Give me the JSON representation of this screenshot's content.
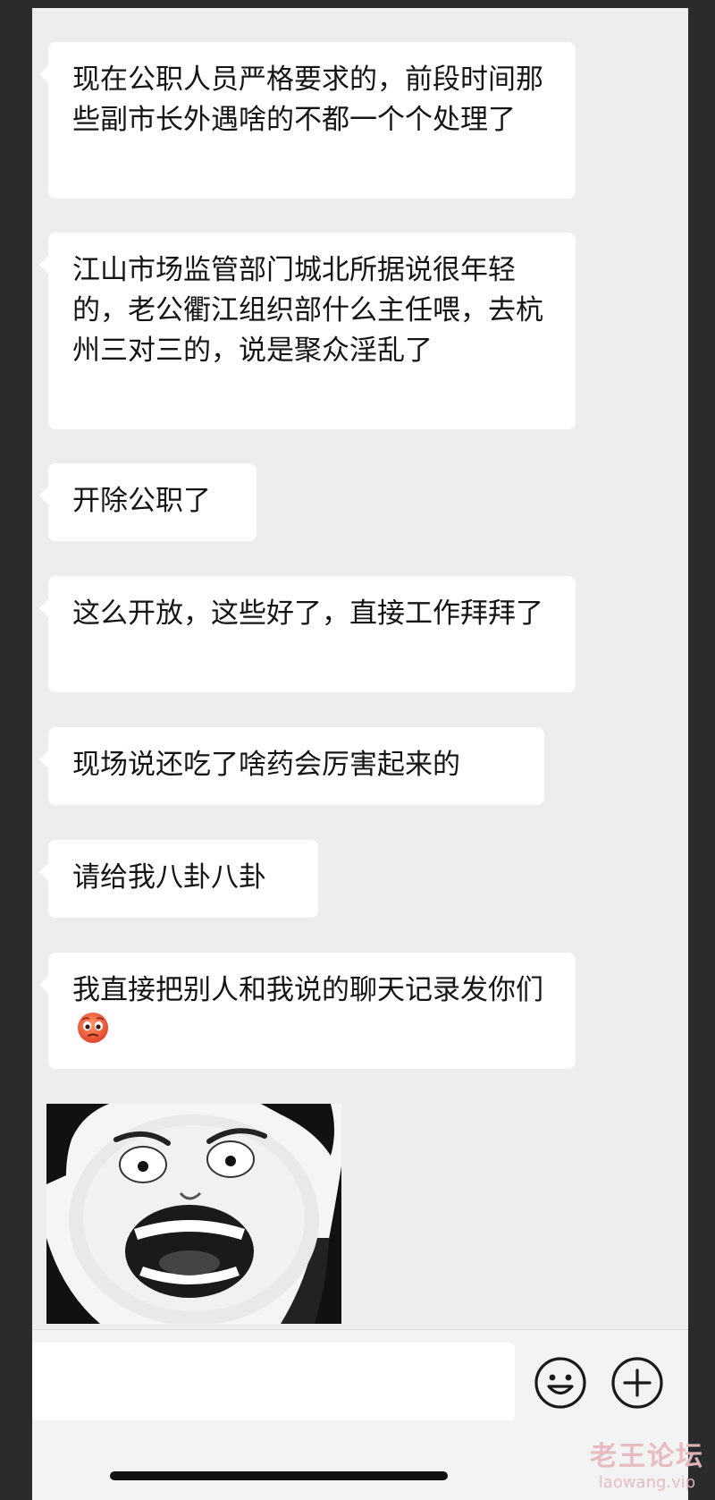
{
  "messages": [
    {
      "text": "现在公职人员严格要求的，前段时间那些副市长外遇啥的不都一个个处理了"
    },
    {
      "text": "江山市场监管部门城北所据说很年轻的，老公衢江组织部什么主任喂，去杭州三对三的，说是聚众淫乱了"
    },
    {
      "text": "开除公职了"
    },
    {
      "text": "这么开放，这些好了，直接工作拜拜了"
    },
    {
      "text": "现场说还吃了啥药会厉害起来的"
    },
    {
      "text": "请给我八卦八卦"
    },
    {
      "text": "我直接把别人和我说的聊天记录发你们",
      "emoji": "blushing-face-emoji"
    }
  ],
  "sticker": {
    "icon": "panda-meme-sticker"
  },
  "input_bar": {
    "text_value": "",
    "emoji_button_icon": "smiley-icon",
    "add_button_icon": "plus-circle-icon"
  },
  "watermark": {
    "title": "老王论坛",
    "url": "laowang.vip"
  },
  "colors": {
    "chat_background": "#ededed",
    "bubble": "#ffffff",
    "text": "#151515",
    "watermark": "#e6b9bf"
  }
}
